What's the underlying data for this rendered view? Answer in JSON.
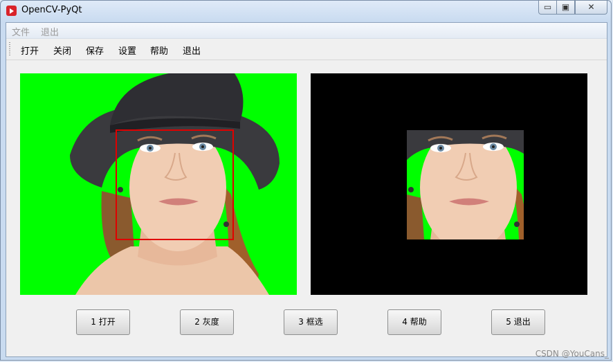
{
  "window": {
    "title": "OpenCV-PyQt"
  },
  "menubar": {
    "items": [
      {
        "label": "文件"
      },
      {
        "label": "退出"
      }
    ]
  },
  "toolbar": {
    "items": [
      {
        "label": "打开"
      },
      {
        "label": "关闭"
      },
      {
        "label": "保存"
      },
      {
        "label": "设置"
      },
      {
        "label": "帮助"
      },
      {
        "label": "退出"
      }
    ]
  },
  "buttons": [
    {
      "label": "1 打开"
    },
    {
      "label": "2 灰度"
    },
    {
      "label": "3 框选"
    },
    {
      "label": "4 帮助"
    },
    {
      "label": "5 退出"
    }
  ],
  "images": {
    "left": {
      "description": "woman-in-hat-on-green-background",
      "roi_color": "#e00000",
      "background": "#00ff00"
    },
    "right": {
      "description": "cropped-face-roi-on-black",
      "background": "#000000"
    }
  },
  "watermark": "CSDN @YouCans_",
  "colors": {
    "title_icon": "#d9232a",
    "menu_disabled": "#9a9a9a"
  }
}
